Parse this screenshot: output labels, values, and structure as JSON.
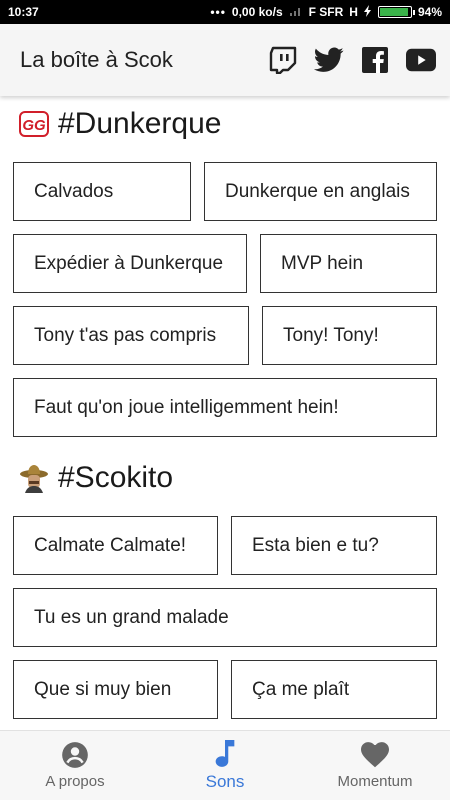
{
  "status_bar": {
    "time": "10:37",
    "dots": "•••",
    "network_speed": "0,00 ko/s",
    "carrier": "F SFR",
    "network_type": "H",
    "battery_percent_label": "94%",
    "battery_level": 0.94
  },
  "app_bar": {
    "title": "La boîte à Scok",
    "icons": [
      "twitch-icon",
      "twitter-icon",
      "facebook-icon",
      "youtube-icon"
    ]
  },
  "sections": [
    {
      "title": "#Dunkerque",
      "icon": "gg-logo-icon",
      "icon_text": "GG",
      "rows": [
        [
          "Calvados",
          "Dunkerque en anglais"
        ],
        [
          "Expédier à Dunkerque",
          "MVP hein"
        ],
        [
          "Tony t'as pas compris",
          "Tony! Tony!"
        ],
        [
          "Faut qu'on joue intelligemment hein!"
        ]
      ]
    },
    {
      "title": "#Scokito",
      "icon": "sombrero-avatar-icon",
      "rows": [
        [
          "Calmate Calmate!",
          "Esta bien e tu?"
        ],
        [
          "Tu es un grand malade"
        ],
        [
          "Que si muy bien",
          "Ça me plaît"
        ]
      ]
    }
  ],
  "bottom_nav": {
    "items": [
      {
        "label": "A propos",
        "icon": "account-circle-icon"
      },
      {
        "label": "Sons",
        "icon": "music-note-icon"
      },
      {
        "label": "Momentum",
        "icon": "heart-icon"
      }
    ],
    "active_index": 1
  },
  "colors": {
    "active_nav": "#3a78d8",
    "inactive_nav": "#666666",
    "gg_red": "#d11f2a",
    "battery_fill": "#3ab34a"
  }
}
